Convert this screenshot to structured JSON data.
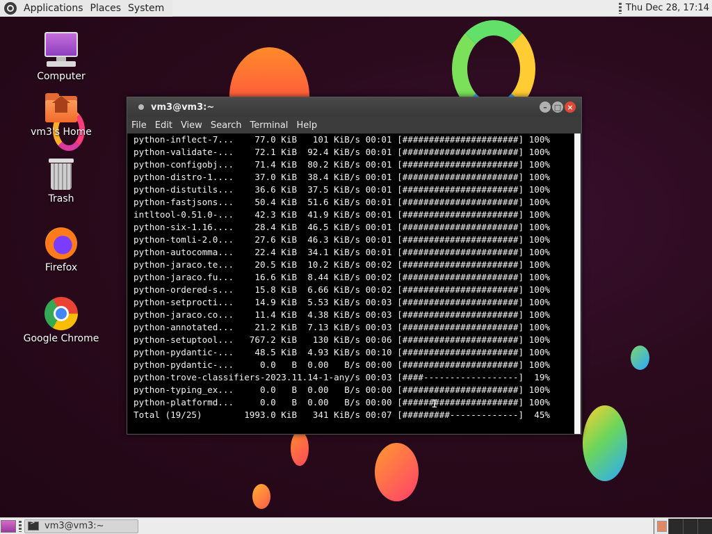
{
  "top_panel": {
    "menus": [
      "Applications",
      "Places",
      "System"
    ],
    "clock": "Thu Dec 28, 17:14"
  },
  "desktop": {
    "icons": [
      {
        "label": "Computer",
        "icon": "computer-icon"
      },
      {
        "label": "vm3's Home",
        "icon": "home-folder-icon"
      },
      {
        "label": "Trash",
        "icon": "trash-icon"
      },
      {
        "label": "Firefox",
        "icon": "firefox-icon"
      },
      {
        "label": "Google Chrome",
        "icon": "chrome-icon"
      }
    ]
  },
  "terminal": {
    "title": "vm3@vm3:~",
    "menu": [
      "File",
      "Edit",
      "View",
      "Search",
      "Terminal",
      "Help"
    ],
    "lines": [
      "python-inflect-7...    77.0 KiB   101 KiB/s 00:01 [######################] 100%",
      "python-validate-...    72.1 KiB  92.4 KiB/s 00:01 [######################] 100%",
      "python-configobj...    71.4 KiB  80.2 KiB/s 00:01 [######################] 100%",
      "python-distro-1....    37.0 KiB  38.4 KiB/s 00:01 [######################] 100%",
      "python-distutils...    36.6 KiB  37.5 KiB/s 00:01 [######################] 100%",
      "python-fastjsons...    50.4 KiB  51.6 KiB/s 00:01 [######################] 100%",
      "intltool-0.51.0-...    42.3 KiB  41.9 KiB/s 00:01 [######################] 100%",
      "python-six-1.16....    28.4 KiB  46.5 KiB/s 00:01 [######################] 100%",
      "python-tomli-2.0...    27.6 KiB  46.3 KiB/s 00:01 [######################] 100%",
      "python-autocomma...    22.4 KiB  34.1 KiB/s 00:01 [######################] 100%",
      "python-jaraco.te...    20.5 KiB  10.2 KiB/s 00:02 [######################] 100%",
      "python-jaraco.fu...    16.6 KiB  8.44 KiB/s 00:02 [######################] 100%",
      "python-ordered-s...    15.8 KiB  6.66 KiB/s 00:02 [######################] 100%",
      "python-setprocti...    14.9 KiB  5.53 KiB/s 00:03 [######################] 100%",
      "python-jaraco.co...    11.4 KiB  4.38 KiB/s 00:03 [######################] 100%",
      "python-annotated...    21.2 KiB  7.13 KiB/s 00:03 [######################] 100%",
      "python-setuptool...   767.2 KiB   130 KiB/s 00:06 [######################] 100%",
      "python-pydantic-...    48.5 KiB  4.93 KiB/s 00:10 [######################] 100%",
      "python-pydantic-...     0.0   B  0.00   B/s 00:00 [######################] 100%",
      "python-trove-classifiers-2023.11.14-1-any/s 00:03 [####------------------]  19%",
      "python-typing_ex...     0.0   B  0.00   B/s 00:00 [######################] 100%",
      "python-platformd...     0.0   B  0.00   B/s 00:00 [######################] 100%",
      "Total (19/25)        1993.0 KiB   341 KiB/s 00:07 [#########-------------]  45%"
    ]
  },
  "bottom_panel": {
    "taskbar_item": "vm3@vm3:~"
  }
}
